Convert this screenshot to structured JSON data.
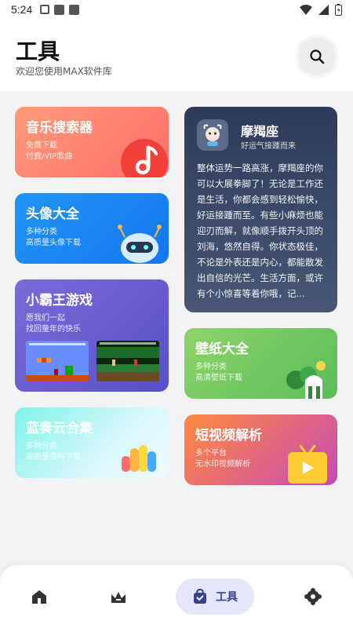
{
  "status_bar": {
    "time": "5:24"
  },
  "header": {
    "title": "工具",
    "subtitle": "欢迎您使用MAX软件库"
  },
  "cards": {
    "music": {
      "title": "音乐搜索器",
      "line1": "免费下载",
      "line2": "付费/VIP歌曲"
    },
    "avatar": {
      "title": "头像大全",
      "line1": "多种分类",
      "line2": "高质量头像下载"
    },
    "game": {
      "title": "小霸王游戏",
      "line1": "愿我们一起",
      "line2": "找回童年的快乐"
    },
    "lanzou": {
      "title": "蓝奏云合集",
      "line1": "多种分类",
      "line2": "高质量资料下载"
    },
    "zodiac": {
      "name": "摩羯座",
      "tag": "好运气接踵而来",
      "text": "整体运势一路高涨，摩羯座的你可以大展拳脚了！无论是工作还是生活，你都会感到轻松愉快，好运接踵而至。有些小麻烦也能迎刃而解，就像顺手拨开头顶的刘海，悠然自得。你状态极佳，不论是外表还是内心，都能散发出自信的光芒。生活方面，或许有个小惊喜等着你哦，记..."
    },
    "wallpaper": {
      "title": "壁纸大全",
      "line1": "多种分类",
      "line2": "高清壁纸下载"
    },
    "video": {
      "title": "短视频解析",
      "line1": "多个平台",
      "line2": "无水印视频解析"
    }
  },
  "bottom_nav": {
    "active_label": "工具",
    "items": [
      "home-icon",
      "crown-icon",
      "tools-bag-icon",
      "settings-icon"
    ]
  },
  "colors": {
    "music": "#ff7a6c",
    "avatar": "#1e88f2",
    "game": "#6a5cd0",
    "lanzou": "#8af0e6",
    "zodiac": "#3a4665",
    "wallpaper": "#6cc35c",
    "video": "#e0644f",
    "nav_active": "#e4e6fb"
  }
}
